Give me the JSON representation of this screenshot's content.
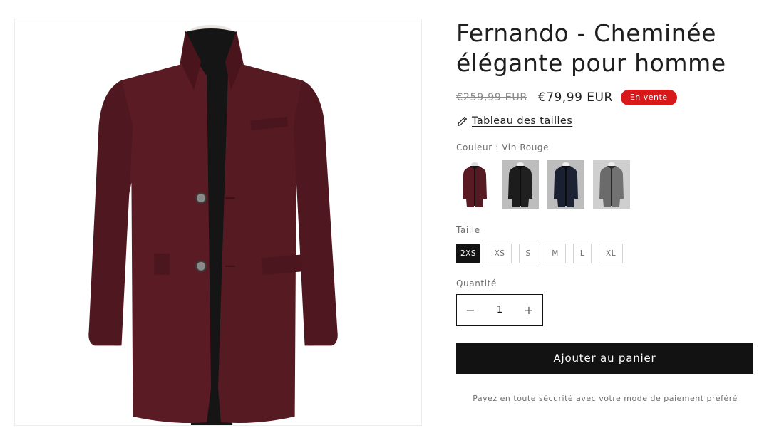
{
  "product": {
    "title": "Fernando - Cheminée élégante pour homme",
    "main_image_icon": "burgundy-wool-coat-image",
    "price_old": "€259,99 EUR",
    "price_new": "€79,99 EUR",
    "sale_badge": "En vente",
    "size_chart_icon": "pencil-ruler-icon",
    "size_chart_label": "Tableau des tailles"
  },
  "color": {
    "label": "Couleur : Vin Rouge",
    "swatches": [
      {
        "name": "Vin Rouge",
        "hex": "#5a1a24",
        "selected": true
      },
      {
        "name": "Noir",
        "hex": "#1c1c1c",
        "selected": false
      },
      {
        "name": "Marine",
        "hex": "#1b2030",
        "selected": false
      },
      {
        "name": "Gris",
        "hex": "#6b6b6b",
        "selected": false
      }
    ]
  },
  "size": {
    "label": "Taille",
    "options": [
      "2XS",
      "XS",
      "S",
      "M",
      "L",
      "XL"
    ],
    "selected": "2XS"
  },
  "quantity": {
    "label": "Quantité",
    "value": "1",
    "minus": "−",
    "plus": "+"
  },
  "cart": {
    "button_label": "Ajouter au panier",
    "secure_note": "Payez en toute sécurité avec votre mode de paiement préféré"
  },
  "colors": {
    "sale": "#d8191a",
    "button": "#121212"
  }
}
